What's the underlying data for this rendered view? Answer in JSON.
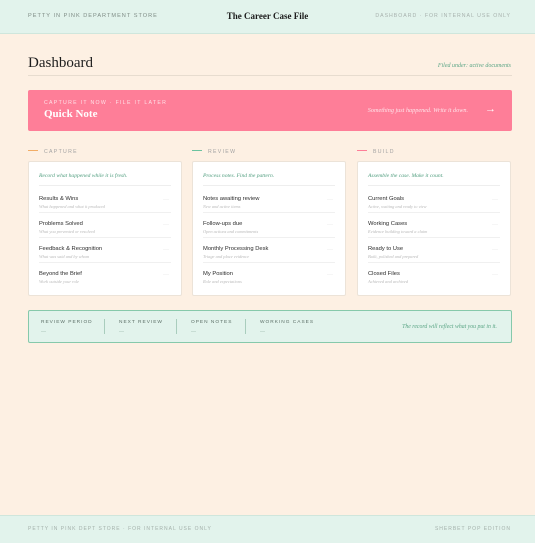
{
  "topbar": {
    "store": "Petty in Pink Department Store",
    "title": "The Career Case File",
    "meta": "Dashboard · For Internal Use Only"
  },
  "page": {
    "title": "Dashboard",
    "filed_under": "Filed under: active documents"
  },
  "quick_note": {
    "eyebrow": "Capture it now · File it later",
    "title": "Quick Note",
    "tagline": "Something just happened. Write it down.",
    "arrow": "→"
  },
  "colors": {
    "capture": "#f2ad66",
    "review": "#6cc3a0",
    "build": "#fe7e98"
  },
  "columns": [
    {
      "heading": "Capture",
      "intro": "Record what happened while it is fresh.",
      "items": [
        {
          "label": "Results & Wins",
          "sub": "What happened and what it produced",
          "more": "···"
        },
        {
          "label": "Problems Solved",
          "sub": "What you prevented or resolved",
          "more": "···"
        },
        {
          "label": "Feedback & Recognition",
          "sub": "What was said and by whom",
          "more": "···"
        },
        {
          "label": "Beyond the Brief",
          "sub": "Work outside your role",
          "more": "···"
        }
      ]
    },
    {
      "heading": "Review",
      "intro": "Process notes. Find the pattern.",
      "items": [
        {
          "label": "Notes awaiting review",
          "sub": "New and active items",
          "more": "···"
        },
        {
          "label": "Follow-ups due",
          "sub": "Open actions and commitments",
          "more": "···"
        },
        {
          "label": "Monthly Processing Desk",
          "sub": "Triage and place evidence",
          "more": "···"
        },
        {
          "label": "My Position",
          "sub": "Role and expectations",
          "more": "···"
        }
      ]
    },
    {
      "heading": "Build",
      "intro": "Assemble the case. Make it count.",
      "items": [
        {
          "label": "Current Goals",
          "sub": "Active, waiting and ready to view",
          "more": "···"
        },
        {
          "label": "Working Cases",
          "sub": "Evidence building toward a claim",
          "more": "···"
        },
        {
          "label": "Ready to Use",
          "sub": "Built, polished and prepared",
          "more": "···"
        },
        {
          "label": "Closed Files",
          "sub": "Achieved and archived",
          "more": "···"
        }
      ]
    }
  ],
  "stats": {
    "items": [
      {
        "label": "Review Period",
        "value": "—"
      },
      {
        "label": "Next Review",
        "value": "—"
      },
      {
        "label": "Open Notes",
        "value": "—"
      },
      {
        "label": "Working Cases",
        "value": "—"
      }
    ],
    "note": "The record will reflect what you put in it."
  },
  "footer": {
    "left": "Petty in Pink Dept Store · For Internal Use Only",
    "right": "Sherbet POP Edition"
  }
}
